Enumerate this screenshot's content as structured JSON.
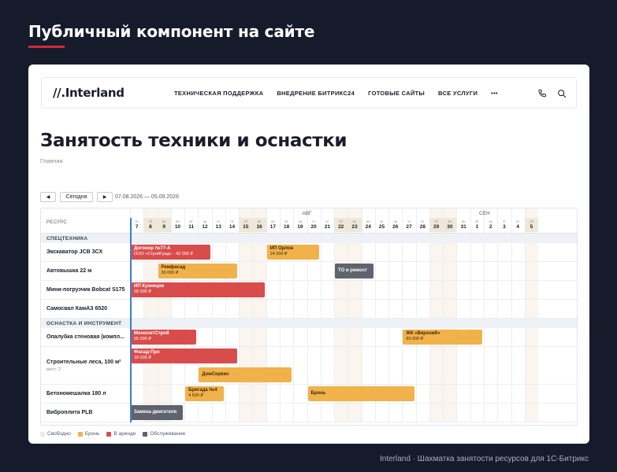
{
  "header": {
    "title": "Публичный компонент на сайте"
  },
  "site": {
    "logo": "//.Interland",
    "nav": [
      "ТЕХНИЧЕСКАЯ ПОДДЕРЖКА",
      "ВНЕДРЕНИЕ БИТРИКС24",
      "ГОТОВЫЕ САЙТЫ",
      "ВСЕ УСЛУГИ",
      "•••"
    ],
    "icons": [
      "phone-icon",
      "search-icon"
    ]
  },
  "page": {
    "title": "Занятость техники и оснастки",
    "breadcrumb": "Главная"
  },
  "toolbar": {
    "prev": "◀",
    "today": "Сегодня",
    "next": "▶",
    "range": "07.08.2026 — 05.09.2026"
  },
  "scheduler": {
    "resource_header": "РЕСУРС",
    "months": [
      {
        "label": "АВГ",
        "day_index": 13
      },
      {
        "label": "СЕН",
        "day_index": 26
      }
    ],
    "days": [
      {
        "wd": "пт",
        "d": "7",
        "weekend": false,
        "today": true
      },
      {
        "wd": "сб",
        "d": "8",
        "weekend": true
      },
      {
        "wd": "вс",
        "d": "9",
        "weekend": true
      },
      {
        "wd": "пн",
        "d": "10",
        "weekend": false
      },
      {
        "wd": "вт",
        "d": "11",
        "weekend": false
      },
      {
        "wd": "ср",
        "d": "12",
        "weekend": false
      },
      {
        "wd": "чт",
        "d": "13",
        "weekend": false
      },
      {
        "wd": "пт",
        "d": "14",
        "weekend": false
      },
      {
        "wd": "сб",
        "d": "15",
        "weekend": true
      },
      {
        "wd": "вс",
        "d": "16",
        "weekend": true
      },
      {
        "wd": "пн",
        "d": "17",
        "weekend": false
      },
      {
        "wd": "вт",
        "d": "18",
        "weekend": false
      },
      {
        "wd": "ср",
        "d": "19",
        "weekend": false
      },
      {
        "wd": "чт",
        "d": "20",
        "weekend": false
      },
      {
        "wd": "пт",
        "d": "21",
        "weekend": false
      },
      {
        "wd": "сб",
        "d": "22",
        "weekend": true
      },
      {
        "wd": "вс",
        "d": "23",
        "weekend": true
      },
      {
        "wd": "пн",
        "d": "24",
        "weekend": false
      },
      {
        "wd": "вт",
        "d": "25",
        "weekend": false
      },
      {
        "wd": "ср",
        "d": "26",
        "weekend": false
      },
      {
        "wd": "чт",
        "d": "27",
        "weekend": false
      },
      {
        "wd": "пт",
        "d": "28",
        "weekend": false
      },
      {
        "wd": "сб",
        "d": "29",
        "weekend": true
      },
      {
        "wd": "вс",
        "d": "30",
        "weekend": true
      },
      {
        "wd": "пн",
        "d": "31",
        "weekend": false
      },
      {
        "wd": "вт",
        "d": "1",
        "weekend": false
      },
      {
        "wd": "ср",
        "d": "2",
        "weekend": false
      },
      {
        "wd": "чт",
        "d": "3",
        "weekend": false
      },
      {
        "wd": "пт",
        "d": "4",
        "weekend": false
      },
      {
        "wd": "сб",
        "d": "5",
        "weekend": true
      }
    ],
    "sections": [
      {
        "title": "СПЕЦТЕХНИКА",
        "rows": [
          {
            "name": "Экскаватор JCB 3CX",
            "bookings": [
              {
                "start": 0,
                "span": 6,
                "status": "rent",
                "title": "Договор №77-А",
                "sub": "ООО «СтройГрад» · 42 000 ₽"
              },
              {
                "start": 10,
                "span": 4,
                "status": "book",
                "title": "ИП Орлов",
                "sub": "24 000 ₽"
              }
            ]
          },
          {
            "name": "Автовышка 22 м",
            "bookings": [
              {
                "start": 2,
                "span": 6,
                "status": "book",
                "title": "Ремфасад",
                "sub": "30 000 ₽"
              },
              {
                "start": 15,
                "span": 3,
                "status": "serv",
                "title": "ТО и ремонт",
                "sub": ""
              }
            ]
          },
          {
            "name": "Мини-погрузчик Bobcat S175",
            "bookings": [
              {
                "start": 0,
                "span": 10,
                "status": "rent",
                "title": "ИП Кузнецов",
                "sub": "28 000 ₽"
              }
            ]
          },
          {
            "name": "Самосвал КамАЗ 6520",
            "bookings": []
          }
        ]
      },
      {
        "title": "ОСНАСТКА И ИНСТРУМЕНТ",
        "rows": [
          {
            "name": "Опалубка стеновая (компл...",
            "bookings": [
              {
                "start": 0,
                "span": 5,
                "status": "rent",
                "title": "МонолитСтрой",
                "sub": "55 000 ₽"
              },
              {
                "start": 20,
                "span": 6,
                "status": "book",
                "title": "ЖК «Верхний»",
                "sub": "60 000 ₽"
              }
            ]
          },
          {
            "name": "Строительные леса, 100 м²",
            "sub": "мест: 2",
            "tall": true,
            "bookings": [
              {
                "start": 0,
                "span": 8,
                "status": "rent",
                "title": "Фасад-Про",
                "sub": "18 000 ₽",
                "lane": 0
              },
              {
                "start": 5,
                "span": 7,
                "status": "book",
                "title": "ДомСервис",
                "sub": "",
                "lane": 1
              }
            ]
          },
          {
            "name": "Бетономешалка 180 л",
            "bookings": [
              {
                "start": 4,
                "span": 3,
                "status": "book",
                "title": "Бригада №4",
                "sub": "4 500 ₽"
              },
              {
                "start": 13,
                "span": 8,
                "status": "book",
                "title": "Бронь",
                "sub": ""
              }
            ]
          },
          {
            "name": "Виброплита PLB",
            "bookings": [
              {
                "start": 0,
                "span": 4,
                "status": "serv",
                "title": "Замена двигателя",
                "sub": ""
              }
            ]
          }
        ]
      }
    ]
  },
  "legend": [
    {
      "label": "Свободно",
      "color": "#e9ebef"
    },
    {
      "label": "Бронь",
      "color": "#f1b24b"
    },
    {
      "label": "В аренде",
      "color": "#d94c4c"
    },
    {
      "label": "Обслуживание",
      "color": "#5e636e"
    }
  ],
  "colors": {
    "accent": "#d32a33",
    "rent": "#d94c4c",
    "book": "#f1b24b",
    "serv": "#5e636e",
    "today": "#3a7bd5"
  },
  "footer": "Interland · Шахматка занятости ресурсов для 1С-Битрикс"
}
